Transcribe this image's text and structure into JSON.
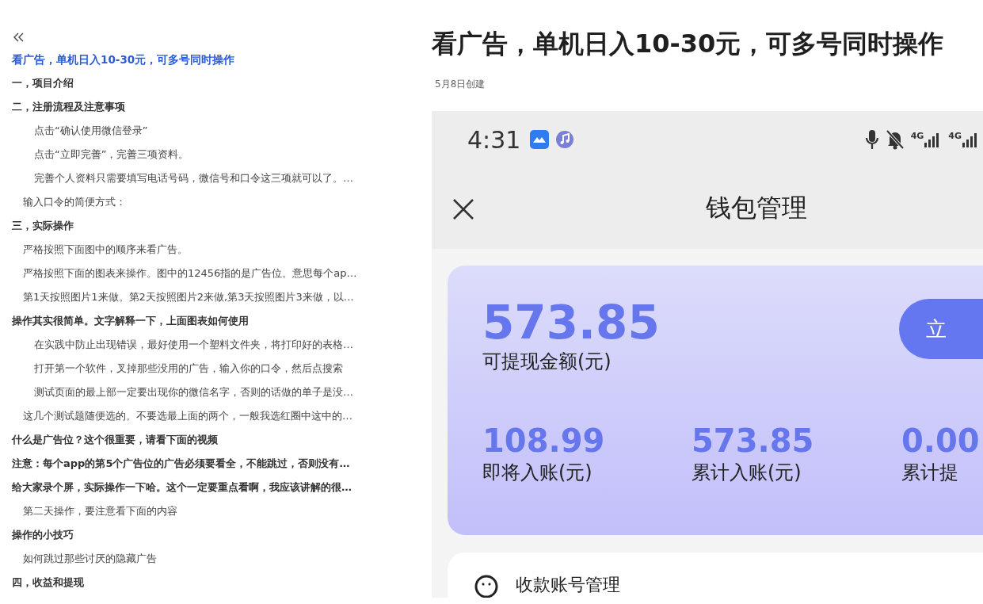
{
  "sidebar": {
    "outline": [
      {
        "kind": "title",
        "text": "看广告，单机日入10-30元，可多号同时操作",
        "selected": true
      },
      {
        "kind": "h2",
        "text": "一，项目介绍",
        "selected": false
      },
      {
        "kind": "h2",
        "text": "二，注册流程及注意事项",
        "selected": false,
        "children": [
          {
            "kind": "h4",
            "text": "点击“确认使用微信登录”",
            "selected": false
          },
          {
            "kind": "h4",
            "text": "点击“立即完善”，完善三项资料。",
            "selected": false
          },
          {
            "kind": "h4",
            "text": "完善个人资料只需要填写电话号码，微信号和口令这三项就可以了。…",
            "selected": false
          },
          {
            "kind": "h3",
            "text": "输入口令的简便方式：",
            "selected": false
          }
        ]
      },
      {
        "kind": "h2",
        "text": "三，实际操作",
        "selected": false,
        "children": [
          {
            "kind": "h3",
            "text": "严格按照下面图中的顺序来看广告。",
            "selected": false
          },
          {
            "kind": "h3",
            "text": "严格按照下面的图表来操作。图中的12456指的是广告位。意思每个ap…",
            "selected": false
          },
          {
            "kind": "h3",
            "text": "第1天按照图片1来做。第2天按照图片2来做,第3天按照图片3来做，以…",
            "selected": false
          }
        ]
      },
      {
        "kind": "h2",
        "text": "操作其实很简单。文字解释一下，上面图表如何使用",
        "selected": false,
        "children": [
          {
            "kind": "h4",
            "text": "在实践中防止出现错误，最好使用一个塑料文件夹，将打印好的表格…",
            "selected": false
          },
          {
            "kind": "h4",
            "text": "打开第一个软件，叉掉那些没用的广告，输入你的口令，然后点搜索",
            "selected": false
          },
          {
            "kind": "h4",
            "text": "测试页面的最上部一定要出现你的微信名字，否则的话做的单子是没…",
            "selected": false
          },
          {
            "kind": "h3",
            "text": "这几个测试题随便选的。不要选最上面的两个，一般我选红圈中这中的…",
            "selected": false
          }
        ]
      },
      {
        "kind": "h2",
        "text": "什么是广告位？这个很重要，请看下面的视频",
        "selected": false
      },
      {
        "kind": "h2",
        "text": "注意：每个app的第5个广告位的广告必须要看全，不能跳过，否则没有…",
        "selected": false
      },
      {
        "kind": "h2",
        "text": "给大家录个屏，实际操作一下哈。这个一定要重点看啊，我应该讲解的很…",
        "selected": false,
        "children": [
          {
            "kind": "h3",
            "text": "第二天操作，要注意看下面的内容",
            "selected": false
          }
        ]
      },
      {
        "kind": "h2",
        "text": "操作的小技巧",
        "selected": false,
        "children": [
          {
            "kind": "h3",
            "text": "如何跳过那些讨厌的隐藏广告",
            "selected": false
          }
        ]
      },
      {
        "kind": "h2",
        "text": "四，收益和提现",
        "selected": false
      }
    ]
  },
  "document": {
    "title": "看广告，单机日入10-30元，可多号同时操作",
    "created": "5月8日创建",
    "screenshot": {
      "status_time": "4:31",
      "network_labels": [
        "4G",
        "4G"
      ],
      "header_title": "钱包管理",
      "balance": {
        "amount": "573.85",
        "label": "可提现金额(元)",
        "button": "立"
      },
      "stats": [
        {
          "value": "108.99",
          "label": "即将入账(元)"
        },
        {
          "value": "573.85",
          "label": "累计入账(元)"
        },
        {
          "value": "0.00",
          "label": "累计提"
        }
      ],
      "menu_items": [
        {
          "label": "收款账号管理"
        }
      ]
    }
  }
}
